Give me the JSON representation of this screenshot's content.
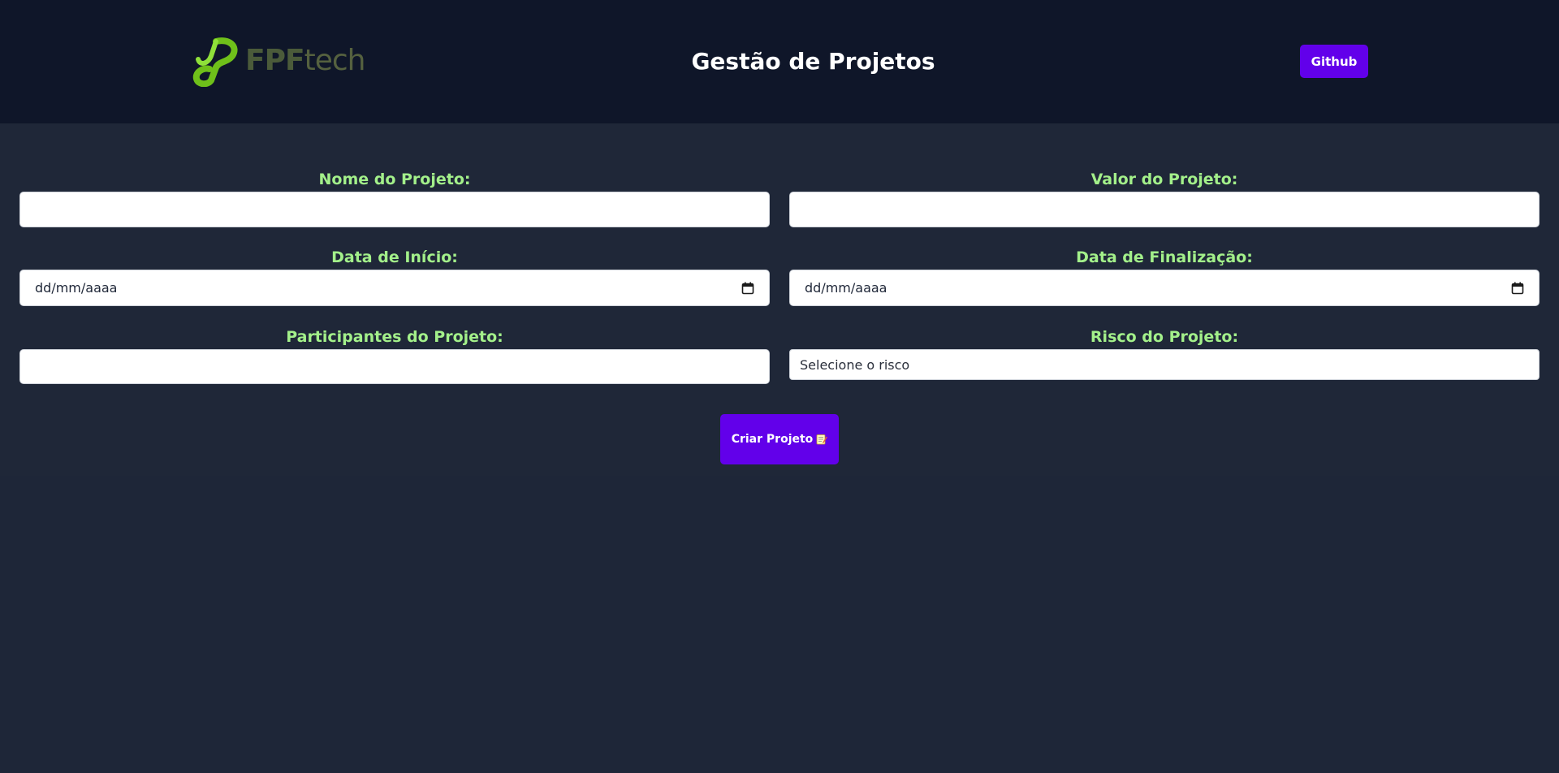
{
  "header": {
    "logo_text_bold": "FPF",
    "logo_text_light": "tech",
    "title": "Gestão de Projetos",
    "github_label": "Github"
  },
  "form": {
    "project_name": {
      "label": "Nome do Projeto:",
      "value": ""
    },
    "project_value": {
      "label": "Valor do Projeto:",
      "value": ""
    },
    "start_date": {
      "label": "Data de Início:",
      "placeholder": "dd/mm/aaaa"
    },
    "end_date": {
      "label": "Data de Finalização:",
      "placeholder": "dd/mm/aaaa"
    },
    "participants": {
      "label": "Participantes do Projeto:",
      "value": ""
    },
    "risk": {
      "label": "Risco do Projeto:",
      "selected": "Selecione o risco"
    },
    "submit_label": "Criar Projeto"
  },
  "colors": {
    "header_bg": "#0f1629",
    "page_bg": "#1e2638",
    "accent": "#6200ea",
    "label": "#a3f08a",
    "logo_green": "#7ed321"
  },
  "icons": {
    "calendar": "calendar-icon",
    "memo": "memo-icon"
  }
}
